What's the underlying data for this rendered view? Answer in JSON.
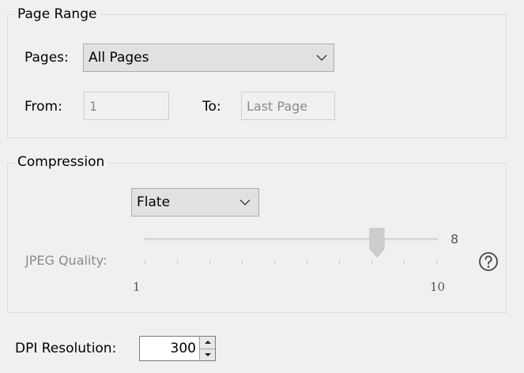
{
  "page_range": {
    "title": "Page Range",
    "pages_label": "Pages:",
    "pages_value": "All Pages",
    "from_label": "From:",
    "from_value": "1",
    "to_label": "To:",
    "to_value": "Last Page"
  },
  "compression": {
    "title": "Compression",
    "method_value": "Flate",
    "jpeg_quality_label": "JPEG Quality:",
    "slider_value": "8",
    "slider_fraction": 0.778,
    "slider_min_label": "1",
    "slider_max_label": "10",
    "help_icon": "question-circle-icon"
  },
  "dpi": {
    "label": "DPI Resolution:",
    "value": "300"
  }
}
